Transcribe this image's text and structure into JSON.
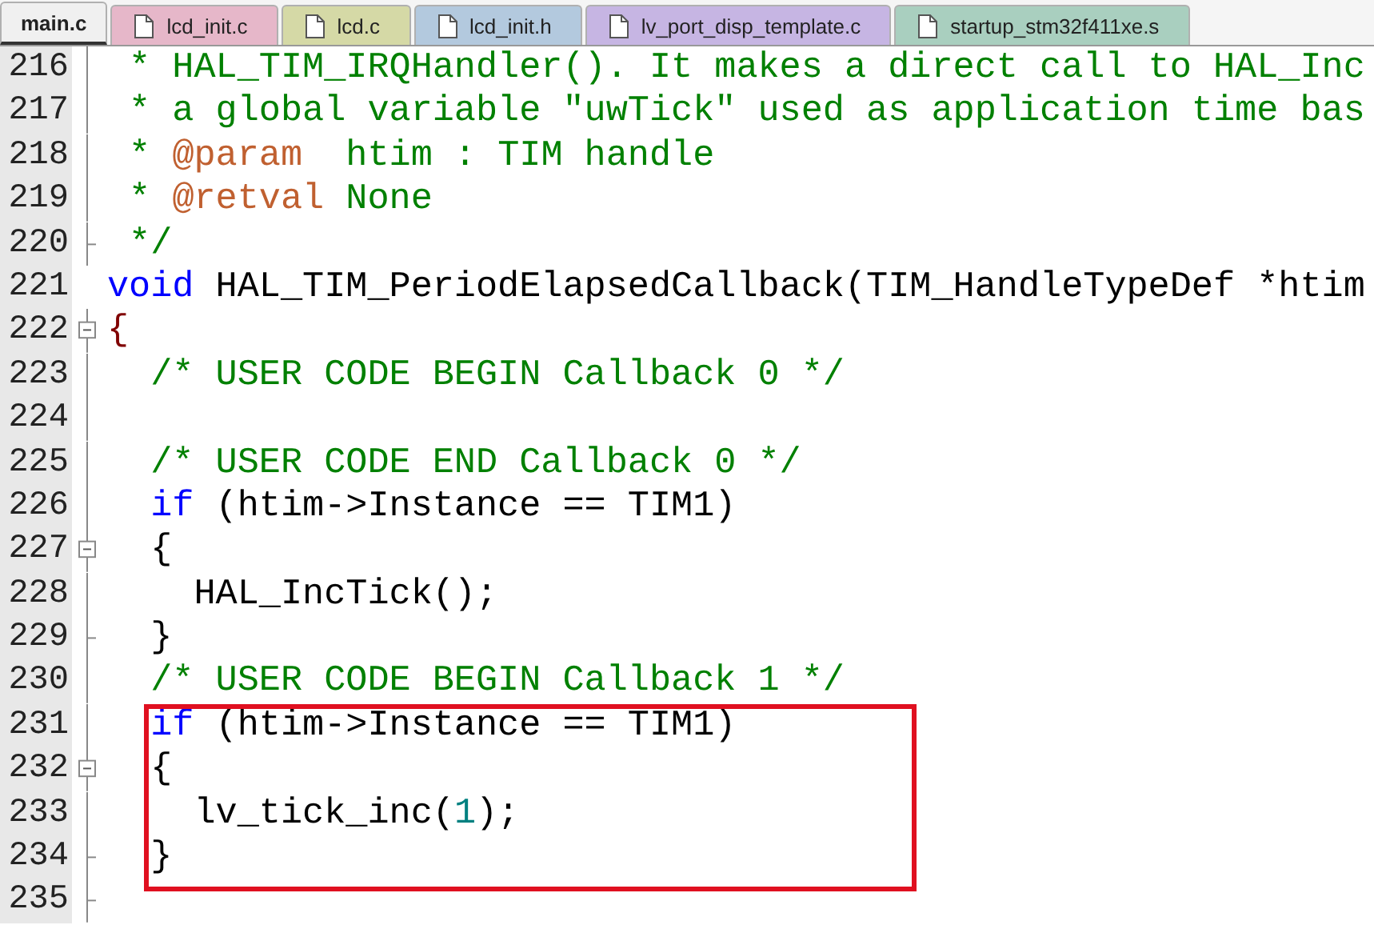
{
  "tabs": [
    {
      "label": "main.c",
      "selected": true,
      "color": "#f0f0f0"
    },
    {
      "label": "lcd_init.c",
      "selected": false,
      "color": "#e6b7c9"
    },
    {
      "label": "lcd.c",
      "selected": false,
      "color": "#d5d9a6"
    },
    {
      "label": "lcd_init.h",
      "selected": false,
      "color": "#b3c9de"
    },
    {
      "label": "lv_port_disp_template.c",
      "selected": false,
      "color": "#c6b5e3"
    },
    {
      "label": "startup_stm32f411xe.s",
      "selected": false,
      "color": "#a9cfbf"
    }
  ],
  "segments": [
    {
      "lines": [
        {
          "number": "216",
          "kind": "line",
          "tokens": [
            {
              "kind": "comment",
              "text": " * HAL_TIM_IRQHandler(). It makes a direct call to HAL_Inc"
            }
          ]
        },
        {
          "number": "217",
          "kind": "line",
          "tokens": [
            {
              "kind": "comment",
              "text": " * a global variable \"uwTick\" used as application time bas"
            }
          ]
        },
        {
          "number": "218",
          "kind": "line",
          "tokens": [
            {
              "kind": "comment",
              "text": " * "
            },
            {
              "kind": "doctag",
              "text": "@param"
            },
            {
              "kind": "comment",
              "text": "  htim : TIM handle"
            }
          ]
        },
        {
          "number": "219",
          "kind": "line",
          "tokens": [
            {
              "kind": "comment",
              "text": " * "
            },
            {
              "kind": "doctag",
              "text": "@retval"
            },
            {
              "kind": "comment",
              "text": " None"
            }
          ]
        },
        {
          "number": "220",
          "kind": "end",
          "tokens": [
            {
              "kind": "comment",
              "text": " */"
            }
          ]
        },
        {
          "number": "221",
          "kind": "plain",
          "tokens": [
            {
              "kind": "keyword",
              "text": "void"
            },
            {
              "kind": "plain",
              "text": " HAL_TIM_PeriodElapsedCallback(TIM_HandleTypeDef *htim"
            }
          ]
        },
        {
          "number": "222",
          "kind": "open",
          "tokens": [
            {
              "kind": "brace",
              "text": "{"
            }
          ]
        },
        {
          "number": "223",
          "kind": "line",
          "tokens": [
            {
              "kind": "comment",
              "text": "  /* USER CODE BEGIN Callback 0 */"
            }
          ]
        },
        {
          "number": "224",
          "kind": "line"
        },
        {
          "number": "225",
          "kind": "line",
          "tokens": [
            {
              "kind": "comment",
              "text": "  /* USER CODE END Callback 0 */"
            }
          ]
        },
        {
          "number": "226",
          "kind": "line",
          "tokens": [
            {
              "kind": "keyword",
              "text": "  if"
            },
            {
              "kind": "plain",
              "text": " (htim->Instance == TIM1)"
            }
          ]
        },
        {
          "number": "227",
          "kind": "open",
          "tokens": [
            {
              "kind": "plain",
              "text": "  {"
            }
          ]
        },
        {
          "number": "228",
          "kind": "line",
          "tokens": [
            {
              "kind": "plain",
              "text": "    HAL_IncTick();"
            }
          ]
        },
        {
          "number": "229",
          "kind": "end",
          "tokens": [
            {
              "kind": "plain",
              "text": "  }"
            }
          ]
        },
        {
          "number": "230",
          "kind": "line",
          "tokens": [
            {
              "kind": "comment",
              "text": "  /* USER CODE BEGIN Callback 1 */"
            }
          ]
        }
      ]
    },
    {
      "boxed": true,
      "lines": [
        {
          "number": "231",
          "kind": "line",
          "tokens": [
            {
              "kind": "keyword",
              "text": "  if"
            },
            {
              "kind": "plain",
              "text": " (htim->Instance == TIM1)"
            }
          ]
        },
        {
          "number": "232",
          "kind": "open",
          "tokens": [
            {
              "kind": "plain",
              "text": "  {"
            }
          ]
        },
        {
          "number": "233",
          "kind": "line",
          "tokens": [
            {
              "kind": "plain",
              "text": "    lv_tick_inc("
            },
            {
              "kind": "number",
              "text": "1"
            },
            {
              "kind": "plain",
              "text": ");"
            }
          ]
        },
        {
          "number": "234",
          "kind": "end",
          "tokens": [
            {
              "kind": "plain",
              "text": "  }"
            }
          ]
        }
      ]
    },
    {
      "lines": [
        {
          "number": "235",
          "kind": "end"
        }
      ]
    }
  ]
}
